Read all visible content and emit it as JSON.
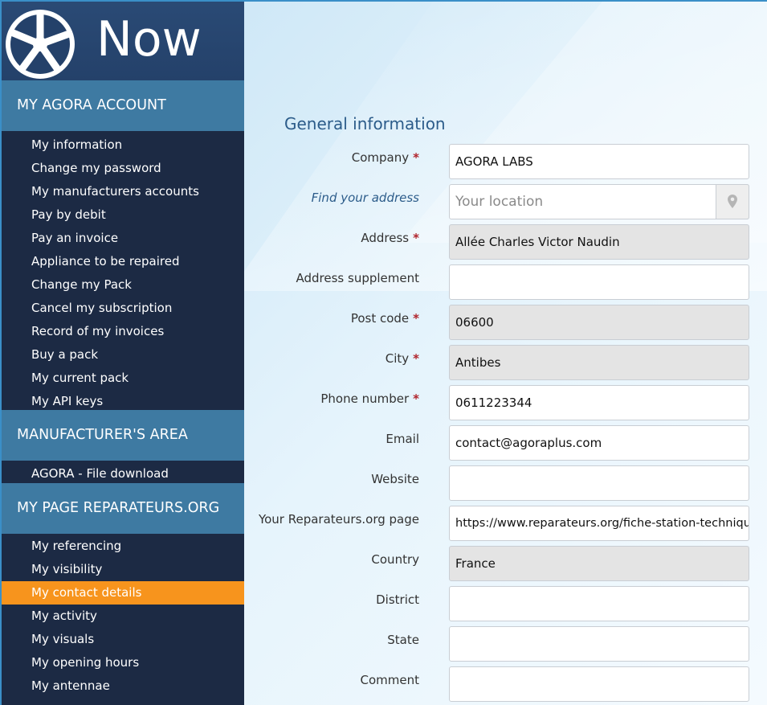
{
  "brand": {
    "name": "Now"
  },
  "sidebar": {
    "sections": [
      {
        "title": "MY AGORA ACCOUNT",
        "items": [
          "My information",
          "Change my password",
          "My manufacturers accounts",
          "Pay by debit",
          "Pay an invoice",
          "Appliance to be repaired",
          "Change my Pack",
          "Cancel my subscription",
          "Record of my invoices",
          "Buy a pack",
          "My current pack",
          "My API keys"
        ]
      },
      {
        "title": "MANUFACTURER'S AREA",
        "items": [
          "AGORA - File download"
        ]
      },
      {
        "title": "MY PAGE REPARATEURS.ORG",
        "items": [
          "My referencing",
          "My visibility",
          "My contact details",
          "My activity",
          "My visuals",
          "My opening hours",
          "My antennae"
        ],
        "active": "My contact details"
      }
    ]
  },
  "form": {
    "title": "General information",
    "required_mark": "*",
    "fields": {
      "company": {
        "label": "Company",
        "value": "AGORA LABS"
      },
      "find_address": {
        "label": "Find your address",
        "placeholder": "Your location"
      },
      "address": {
        "label": "Address",
        "value": "Allée Charles Victor Naudin"
      },
      "address_supplement": {
        "label": "Address supplement",
        "value": ""
      },
      "post_code": {
        "label": "Post code",
        "value": "06600"
      },
      "city": {
        "label": "City",
        "value": "Antibes"
      },
      "phone": {
        "label": "Phone number",
        "value": "0611223344"
      },
      "email": {
        "label": "Email",
        "value": "contact@agoraplus.com"
      },
      "website": {
        "label": "Website",
        "value": ""
      },
      "reparateurs_page": {
        "label": "Your Reparateurs.org page",
        "value": "https://www.reparateurs.org/fiche-station-technique/R"
      },
      "country": {
        "label": "Country",
        "value": "France"
      },
      "district": {
        "label": "District",
        "value": ""
      },
      "state": {
        "label": "State",
        "value": ""
      },
      "comment": {
        "label": "Comment",
        "value": ""
      }
    }
  },
  "colors": {
    "sidebar_bg": "#1c2a44",
    "section_header": "#3e7aa2",
    "active_item": "#f7941d",
    "required": "#b0242c"
  },
  "icons": {
    "logo": "wheel-logo-icon",
    "location": "map-pin-icon"
  }
}
